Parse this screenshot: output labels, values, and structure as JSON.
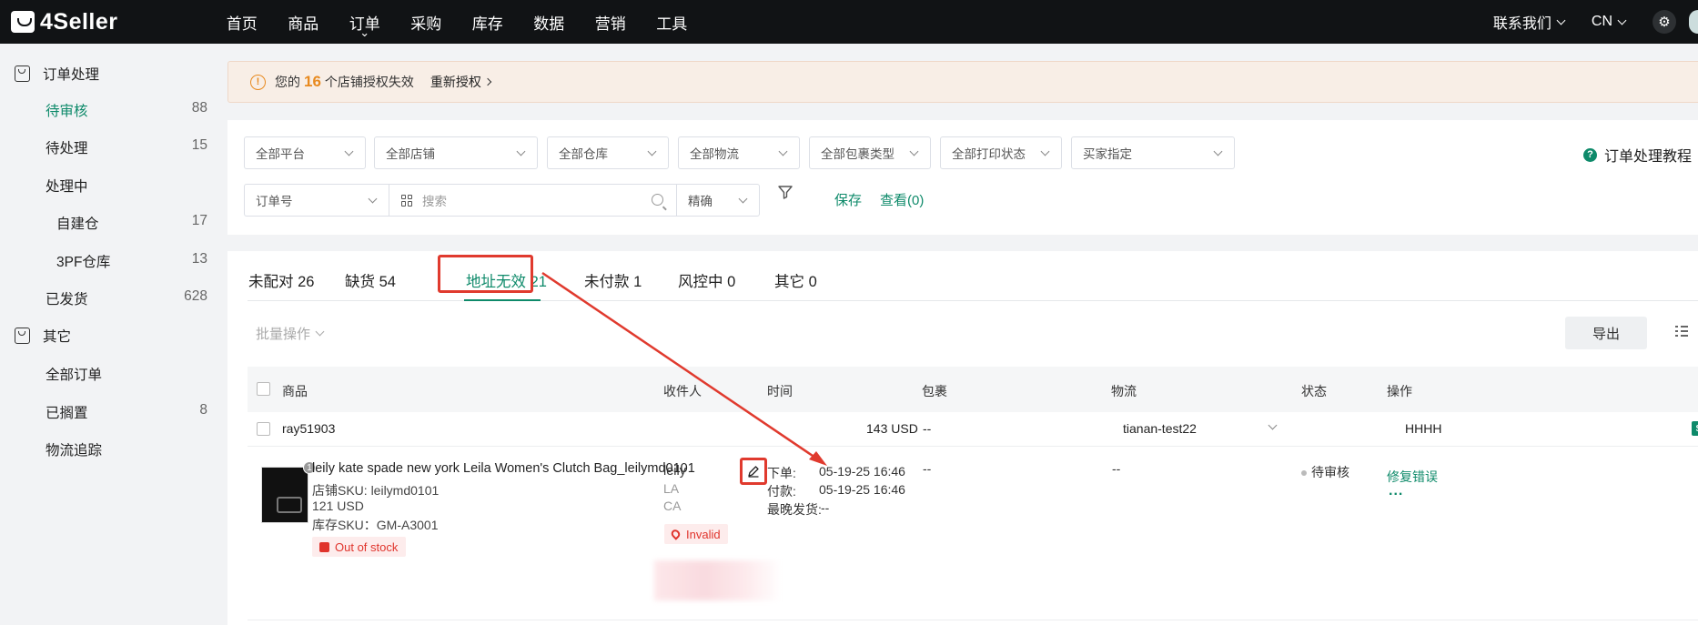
{
  "brand": {
    "name": "4Seller"
  },
  "nav": {
    "items": [
      "首页",
      "商品",
      "订单",
      "采购",
      "库存",
      "数据",
      "营销",
      "工具"
    ],
    "contact_label": "联系我们",
    "lang_label": "CN"
  },
  "sidebar": {
    "group1": "订单处理",
    "items": [
      {
        "label": "待审核",
        "count": "88"
      },
      {
        "label": "待处理",
        "count": "15"
      },
      {
        "label": "处理中",
        "count": ""
      },
      {
        "label": "自建仓",
        "count": "17"
      },
      {
        "label": "3PF仓库",
        "count": "13"
      },
      {
        "label": "已发货",
        "count": "628"
      }
    ],
    "group2": "其它",
    "items2": [
      {
        "label": "全部订单",
        "count": ""
      },
      {
        "label": "已搁置",
        "count": "8"
      },
      {
        "label": "物流追踪",
        "count": ""
      }
    ]
  },
  "alert": {
    "prefix": "您的",
    "count": "16",
    "suffix": "个店铺授权失效",
    "action": "重新授权"
  },
  "filters": {
    "row1": [
      "全部平台",
      "全部店铺",
      "全部仓库",
      "全部物流",
      "全部包裹类型",
      "全部打印状态",
      "买家指定"
    ],
    "order_field": "订单号",
    "search_placeholder": "搜索",
    "match_mode": "精确",
    "save_label": "保存",
    "view_label": "查看(0)",
    "tutorial_label": "订单处理教程"
  },
  "tabs": [
    {
      "label": "未配对 26"
    },
    {
      "label": "缺货 54"
    },
    {
      "label": "地址无效 21"
    },
    {
      "label": "未付款 1"
    },
    {
      "label": "风控中 0"
    },
    {
      "label": "其它 0"
    }
  ],
  "toolbar": {
    "batch_label": "批量操作",
    "export_label": "导出"
  },
  "table": {
    "headers": [
      "商品",
      "收件人",
      "时间",
      "包裹",
      "物流",
      "状态",
      "操作"
    ],
    "group": {
      "buyer": "ray51903",
      "amount": "143 USD",
      "package": "--",
      "logistics": "tianan-test22",
      "store": "HHHH"
    },
    "row": {
      "thumb_badge": "1",
      "product_name": "leily kate spade new york Leila Women's Clutch Bag_leilymd0101",
      "store_sku": "店铺SKU: leilymd0101",
      "price": "121 USD",
      "stock_sku": "库存SKU：GM-A3001",
      "stock_tag": "Out of stock",
      "recipient_name": "leily",
      "recipient_city": "LA",
      "recipient_state": "CA",
      "address_tag": "Invalid",
      "time_order_label": "下单:",
      "time_order": "05-19-25 16:46",
      "time_pay_label": "付款:",
      "time_pay": "05-19-25 16:46",
      "time_ship_label": "最晚发货:",
      "time_ship": "--",
      "package": "--",
      "logistics": "--",
      "status": "待审核",
      "action": "修复错误",
      "more": "..."
    }
  },
  "colors": {
    "accent": "#0e8a6a",
    "annotation": "#e03a2e",
    "warning": "#e88a1f"
  }
}
